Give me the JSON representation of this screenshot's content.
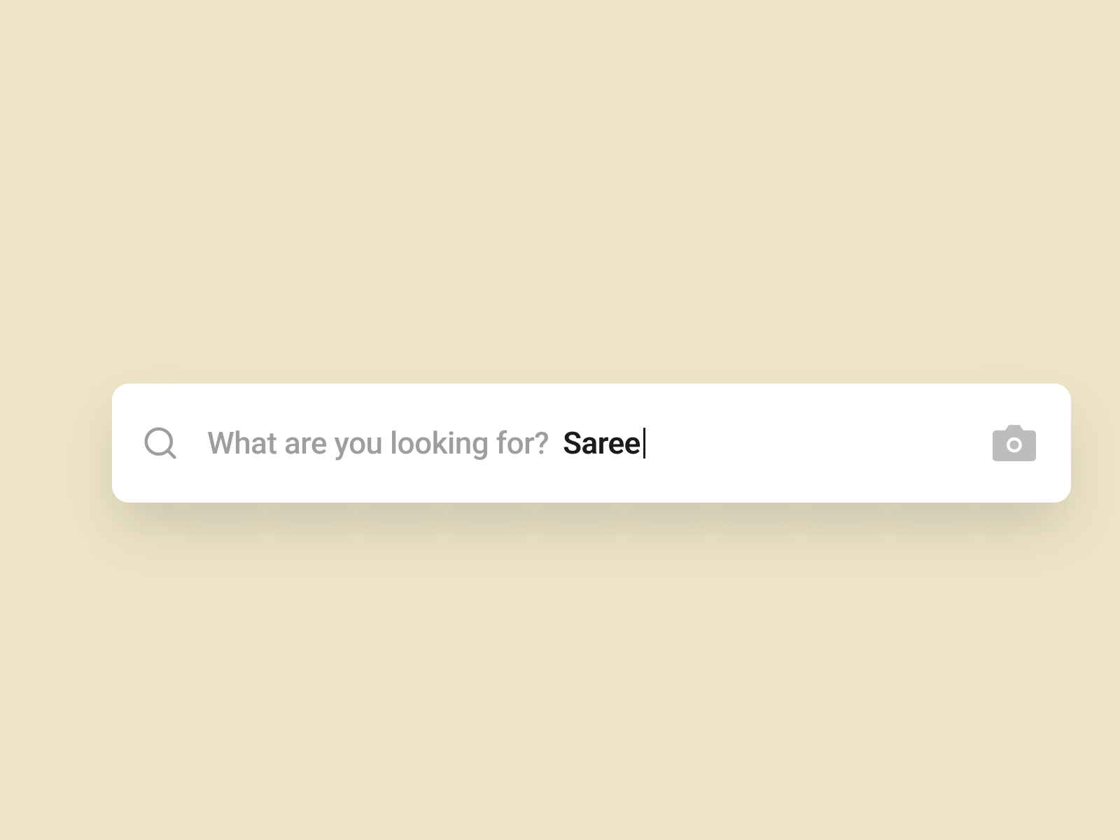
{
  "search": {
    "placeholder": "What are you looking for?",
    "value": "Saree"
  }
}
